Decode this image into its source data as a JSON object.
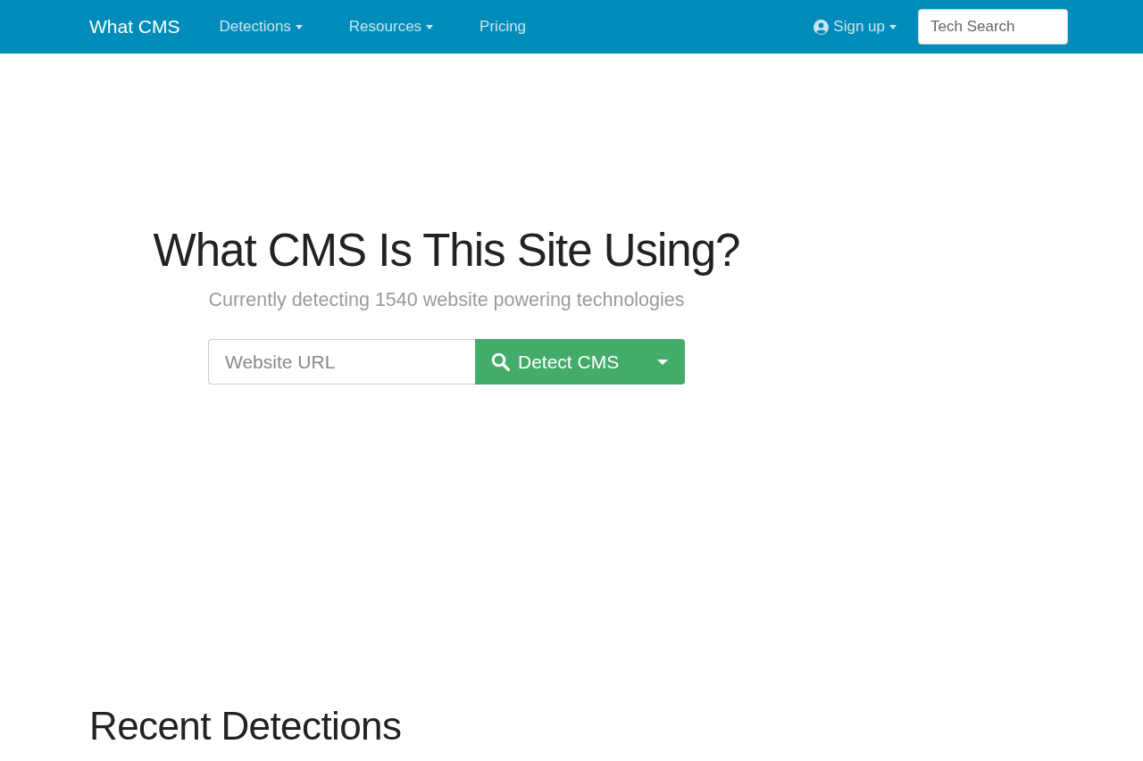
{
  "navbar": {
    "brand": "What CMS",
    "links": [
      {
        "label": "Detections",
        "dropdown": true
      },
      {
        "label": "Resources",
        "dropdown": true
      },
      {
        "label": "Pricing",
        "dropdown": false
      }
    ],
    "account": {
      "label": "Sign up",
      "dropdown": true
    },
    "search": {
      "placeholder": "Tech Search"
    }
  },
  "hero": {
    "title": "What CMS Is This Site Using?",
    "subtitle": "Currently detecting 1540 website powering technologies",
    "url_field": {
      "placeholder": "Website URL"
    },
    "detect_button": {
      "label": "Detect CMS"
    }
  },
  "recent": {
    "title": "Recent Detections"
  }
}
